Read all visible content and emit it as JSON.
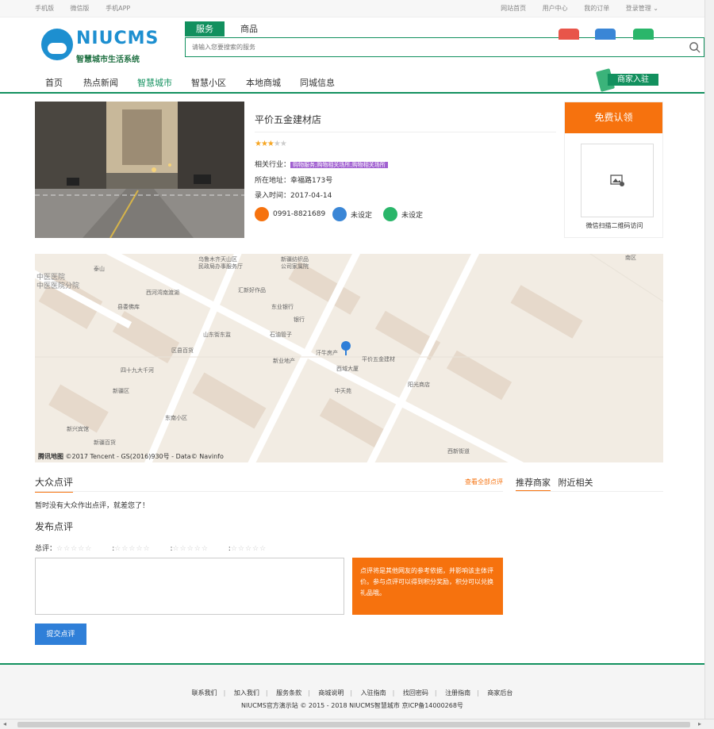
{
  "topbar": {
    "left": [
      "手机版",
      "微信版",
      "手机APP"
    ],
    "right": [
      "网站首页",
      "用户中心",
      "我的订单",
      "登录管理 ⌄"
    ]
  },
  "logo": {
    "brand": "NIUCMS",
    "slogan": "智慧城市生活系统"
  },
  "search": {
    "tabs": [
      "服务",
      "商品"
    ],
    "placeholder": "请输入您要搜索的服务"
  },
  "nav": {
    "items": [
      "首页",
      "热点新闻",
      "智慧城市",
      "智慧小区",
      "本地商城",
      "同城信息"
    ],
    "active": 2,
    "join": "商家入驻"
  },
  "shop": {
    "name": "平价五金建材店",
    "rating": 3,
    "rating_max": 5,
    "industry_label": "相关行业：",
    "industry_tag": "购物服务;购物相关场所;购物相关场所",
    "address_label": "所在地址：",
    "address": "幸福路173号",
    "date_label": "录入时间：",
    "date": "2017-04-14",
    "phone": "0991-8821689",
    "qq": "未设定",
    "wechat": "未设定",
    "claim": "免费认领",
    "qr_caption": "微信扫描二维码访问"
  },
  "map": {
    "labels": [
      "乌鲁木齐天山区",
      "民政局办事服务厅",
      "新疆纺织品",
      "公司家属院",
      "泰山",
      "中医医院",
      "中医医院分院",
      "西河湾南渡湖",
      "汇新好作品",
      "县委佛库",
      "东业银行",
      "银行",
      "山东街东监",
      "区县百货",
      "石油管子",
      "汗牛房产",
      "平价五金建材",
      "西域大厦",
      "新业地产",
      "四十九大千河",
      "南区",
      "新疆区",
      "中天苑",
      "阳光商店",
      "东南小区",
      "新兴宾馆",
      "新疆百货",
      "西新街道"
    ],
    "copyright": "©2017 Tencent - GS(2016)930号 - Data© Navinfo",
    "logo": "腾讯地图"
  },
  "reviews": {
    "title": "大众点评",
    "view_all": "查看全部点评",
    "empty": "暂时没有大众作出点评，就差您了！",
    "post_title": "发布点评",
    "total_label": "总评：",
    "stars": "☆☆☆☆☆",
    "tip": "点评将是其他网友的参考依据，并影响该主体评价。参与点评可以得到积分奖励，积分可以兑换礼品哦。",
    "submit": "提交点评"
  },
  "side": {
    "tabs": [
      "推荐商家",
      "附近相关"
    ]
  },
  "footer": {
    "links": [
      "联系我们",
      "加入我们",
      "服务条款",
      "商城说明",
      "入驻指南",
      "找回密码",
      "注册指南",
      "商家后台"
    ],
    "copyright": "NIUCMS官方演示站  © 2015 - 2018  NIUCMS智慧城市  京ICP备14000268号"
  },
  "colors": {
    "green": "#12905e",
    "orange": "#f6720e",
    "blue": "#2f7fd8",
    "purple": "#a05fd0"
  }
}
